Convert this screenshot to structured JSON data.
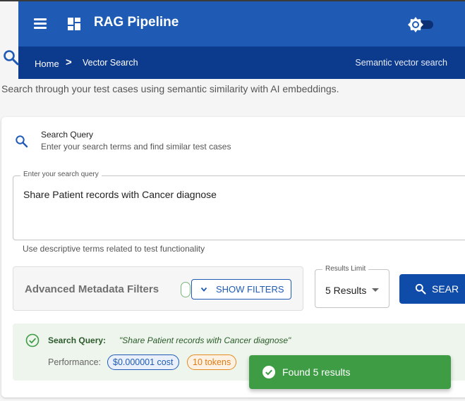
{
  "header": {
    "title": "RAG Pipeline",
    "icons": {
      "menu": "menu-icon",
      "logo": "dashboard-icon",
      "theme": "brightness-icon"
    }
  },
  "breadcrumb": {
    "home": "Home",
    "separator": ">",
    "current": "Vector Search",
    "right_text": "Semantic vector search"
  },
  "page": {
    "subtitle": "Search through your test cases using semantic similarity with AI embeddings."
  },
  "search_card": {
    "title": "Search Query",
    "subtitle": "Enter your search terms and find similar test cases",
    "query_label": "Enter your search query",
    "query_value": "Share Patient records with Cancer diagnose",
    "helper_text": "Use descriptive terms related to test functionality"
  },
  "filters": {
    "title": "Advanced Metadata Filters",
    "toggle_button": "SHOW FILTERS"
  },
  "results_limit": {
    "label": "Results Limit",
    "value": "5 Results"
  },
  "search_button": {
    "label": "SEAR"
  },
  "result_summary": {
    "query_label": "Search Query:",
    "query_value": "\"Share Patient records with Cancer diagnose\"",
    "performance_label": "Performance:",
    "cost": "$0.000001 cost",
    "tokens": "10 tokens"
  },
  "toast": {
    "message": "Found 5 results"
  },
  "colors": {
    "app_bar": "#1f5bb5",
    "breadcrumb_bar": "#0c3a8d",
    "primary": "#0f4ba8",
    "success": "#3e9c45",
    "warning": "#e58a1f"
  }
}
